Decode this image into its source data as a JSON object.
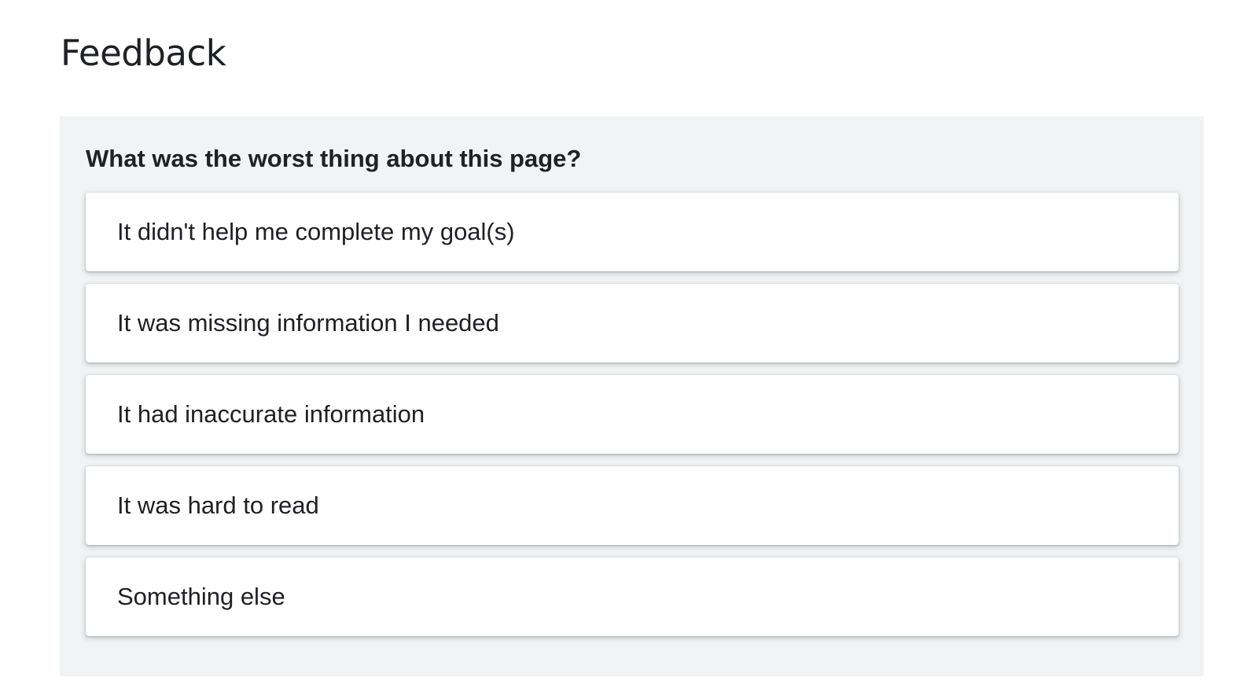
{
  "page": {
    "title": "Feedback"
  },
  "feedback": {
    "question": "What was the worst thing about this page?",
    "options": [
      {
        "label": "It didn't help me complete my goal(s)"
      },
      {
        "label": "It was missing information I needed"
      },
      {
        "label": "It had inaccurate information"
      },
      {
        "label": "It was hard to read"
      },
      {
        "label": "Something else"
      }
    ]
  },
  "colors": {
    "panel_background": "#f1f3f4",
    "option_background": "#ffffff",
    "text": "#202124"
  }
}
